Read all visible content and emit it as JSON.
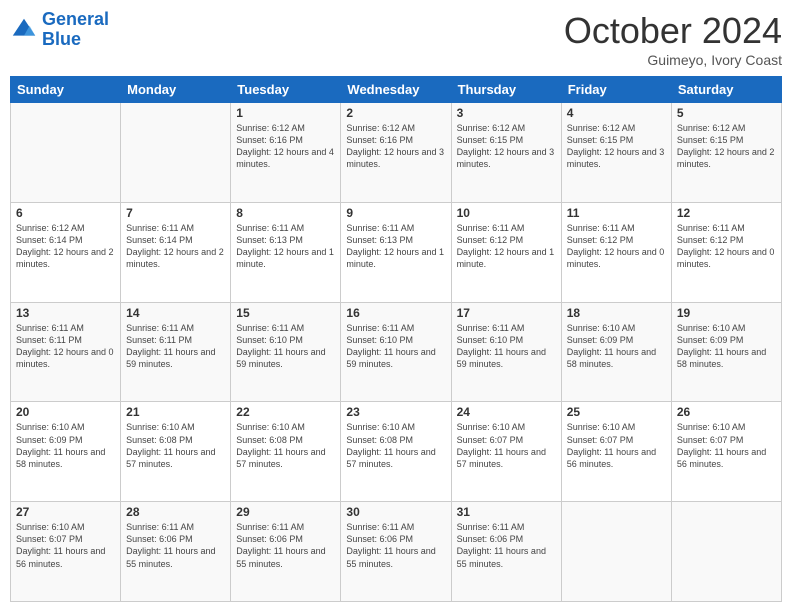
{
  "header": {
    "logo_line1": "General",
    "logo_line2": "Blue",
    "month_title": "October 2024",
    "subtitle": "Guimeyo, Ivory Coast"
  },
  "weekdays": [
    "Sunday",
    "Monday",
    "Tuesday",
    "Wednesday",
    "Thursday",
    "Friday",
    "Saturday"
  ],
  "weeks": [
    [
      {
        "day": "",
        "sunrise": "",
        "sunset": "",
        "daylight": ""
      },
      {
        "day": "",
        "sunrise": "",
        "sunset": "",
        "daylight": ""
      },
      {
        "day": "1",
        "sunrise": "Sunrise: 6:12 AM",
        "sunset": "Sunset: 6:16 PM",
        "daylight": "Daylight: 12 hours and 4 minutes."
      },
      {
        "day": "2",
        "sunrise": "Sunrise: 6:12 AM",
        "sunset": "Sunset: 6:16 PM",
        "daylight": "Daylight: 12 hours and 3 minutes."
      },
      {
        "day": "3",
        "sunrise": "Sunrise: 6:12 AM",
        "sunset": "Sunset: 6:15 PM",
        "daylight": "Daylight: 12 hours and 3 minutes."
      },
      {
        "day": "4",
        "sunrise": "Sunrise: 6:12 AM",
        "sunset": "Sunset: 6:15 PM",
        "daylight": "Daylight: 12 hours and 3 minutes."
      },
      {
        "day": "5",
        "sunrise": "Sunrise: 6:12 AM",
        "sunset": "Sunset: 6:15 PM",
        "daylight": "Daylight: 12 hours and 2 minutes."
      }
    ],
    [
      {
        "day": "6",
        "sunrise": "Sunrise: 6:12 AM",
        "sunset": "Sunset: 6:14 PM",
        "daylight": "Daylight: 12 hours and 2 minutes."
      },
      {
        "day": "7",
        "sunrise": "Sunrise: 6:11 AM",
        "sunset": "Sunset: 6:14 PM",
        "daylight": "Daylight: 12 hours and 2 minutes."
      },
      {
        "day": "8",
        "sunrise": "Sunrise: 6:11 AM",
        "sunset": "Sunset: 6:13 PM",
        "daylight": "Daylight: 12 hours and 1 minute."
      },
      {
        "day": "9",
        "sunrise": "Sunrise: 6:11 AM",
        "sunset": "Sunset: 6:13 PM",
        "daylight": "Daylight: 12 hours and 1 minute."
      },
      {
        "day": "10",
        "sunrise": "Sunrise: 6:11 AM",
        "sunset": "Sunset: 6:12 PM",
        "daylight": "Daylight: 12 hours and 1 minute."
      },
      {
        "day": "11",
        "sunrise": "Sunrise: 6:11 AM",
        "sunset": "Sunset: 6:12 PM",
        "daylight": "Daylight: 12 hours and 0 minutes."
      },
      {
        "day": "12",
        "sunrise": "Sunrise: 6:11 AM",
        "sunset": "Sunset: 6:12 PM",
        "daylight": "Daylight: 12 hours and 0 minutes."
      }
    ],
    [
      {
        "day": "13",
        "sunrise": "Sunrise: 6:11 AM",
        "sunset": "Sunset: 6:11 PM",
        "daylight": "Daylight: 12 hours and 0 minutes."
      },
      {
        "day": "14",
        "sunrise": "Sunrise: 6:11 AM",
        "sunset": "Sunset: 6:11 PM",
        "daylight": "Daylight: 11 hours and 59 minutes."
      },
      {
        "day": "15",
        "sunrise": "Sunrise: 6:11 AM",
        "sunset": "Sunset: 6:10 PM",
        "daylight": "Daylight: 11 hours and 59 minutes."
      },
      {
        "day": "16",
        "sunrise": "Sunrise: 6:11 AM",
        "sunset": "Sunset: 6:10 PM",
        "daylight": "Daylight: 11 hours and 59 minutes."
      },
      {
        "day": "17",
        "sunrise": "Sunrise: 6:11 AM",
        "sunset": "Sunset: 6:10 PM",
        "daylight": "Daylight: 11 hours and 59 minutes."
      },
      {
        "day": "18",
        "sunrise": "Sunrise: 6:10 AM",
        "sunset": "Sunset: 6:09 PM",
        "daylight": "Daylight: 11 hours and 58 minutes."
      },
      {
        "day": "19",
        "sunrise": "Sunrise: 6:10 AM",
        "sunset": "Sunset: 6:09 PM",
        "daylight": "Daylight: 11 hours and 58 minutes."
      }
    ],
    [
      {
        "day": "20",
        "sunrise": "Sunrise: 6:10 AM",
        "sunset": "Sunset: 6:09 PM",
        "daylight": "Daylight: 11 hours and 58 minutes."
      },
      {
        "day": "21",
        "sunrise": "Sunrise: 6:10 AM",
        "sunset": "Sunset: 6:08 PM",
        "daylight": "Daylight: 11 hours and 57 minutes."
      },
      {
        "day": "22",
        "sunrise": "Sunrise: 6:10 AM",
        "sunset": "Sunset: 6:08 PM",
        "daylight": "Daylight: 11 hours and 57 minutes."
      },
      {
        "day": "23",
        "sunrise": "Sunrise: 6:10 AM",
        "sunset": "Sunset: 6:08 PM",
        "daylight": "Daylight: 11 hours and 57 minutes."
      },
      {
        "day": "24",
        "sunrise": "Sunrise: 6:10 AM",
        "sunset": "Sunset: 6:07 PM",
        "daylight": "Daylight: 11 hours and 57 minutes."
      },
      {
        "day": "25",
        "sunrise": "Sunrise: 6:10 AM",
        "sunset": "Sunset: 6:07 PM",
        "daylight": "Daylight: 11 hours and 56 minutes."
      },
      {
        "day": "26",
        "sunrise": "Sunrise: 6:10 AM",
        "sunset": "Sunset: 6:07 PM",
        "daylight": "Daylight: 11 hours and 56 minutes."
      }
    ],
    [
      {
        "day": "27",
        "sunrise": "Sunrise: 6:10 AM",
        "sunset": "Sunset: 6:07 PM",
        "daylight": "Daylight: 11 hours and 56 minutes."
      },
      {
        "day": "28",
        "sunrise": "Sunrise: 6:11 AM",
        "sunset": "Sunset: 6:06 PM",
        "daylight": "Daylight: 11 hours and 55 minutes."
      },
      {
        "day": "29",
        "sunrise": "Sunrise: 6:11 AM",
        "sunset": "Sunset: 6:06 PM",
        "daylight": "Daylight: 11 hours and 55 minutes."
      },
      {
        "day": "30",
        "sunrise": "Sunrise: 6:11 AM",
        "sunset": "Sunset: 6:06 PM",
        "daylight": "Daylight: 11 hours and 55 minutes."
      },
      {
        "day": "31",
        "sunrise": "Sunrise: 6:11 AM",
        "sunset": "Sunset: 6:06 PM",
        "daylight": "Daylight: 11 hours and 55 minutes."
      },
      {
        "day": "",
        "sunrise": "",
        "sunset": "",
        "daylight": ""
      },
      {
        "day": "",
        "sunrise": "",
        "sunset": "",
        "daylight": ""
      }
    ]
  ]
}
